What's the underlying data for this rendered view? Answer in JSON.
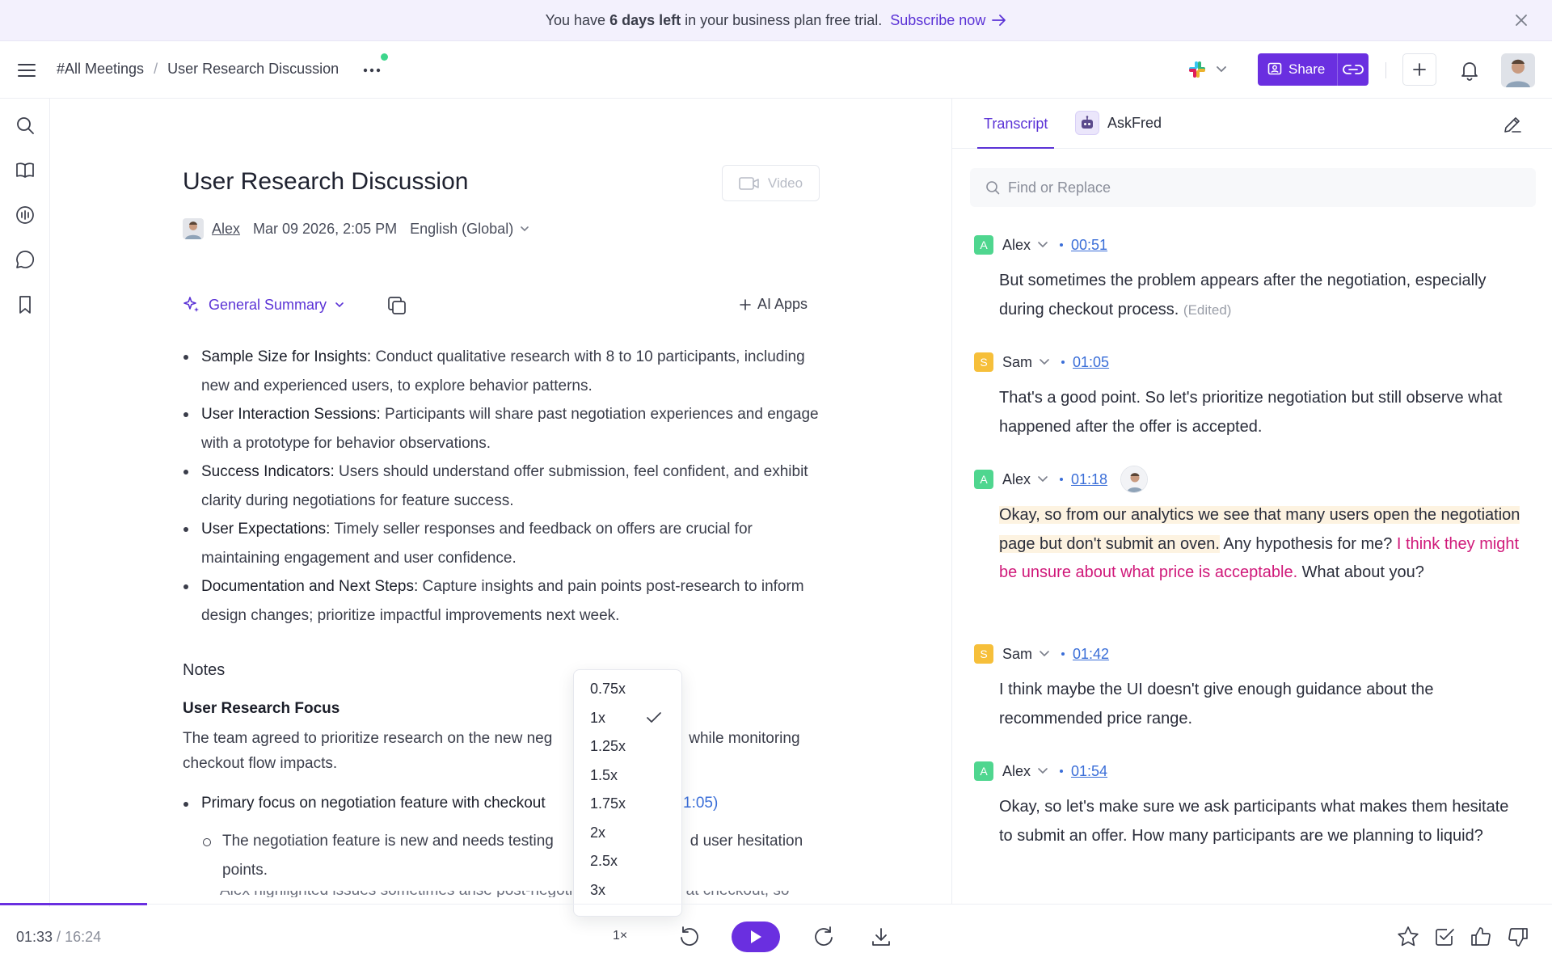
{
  "banner": {
    "prefix": "You have",
    "days": "6 days left",
    "suffix": "in your business plan free trial.",
    "link": "Subscribe now"
  },
  "header": {
    "breadcrumb_root": "#All Meetings",
    "breadcrumb_sep": "/",
    "breadcrumb_current": "User Research Discussion",
    "share_label": "Share"
  },
  "doc": {
    "title": "User Research Discussion",
    "video_label": "Video",
    "author": "Alex",
    "date": "Mar 09 2026, 2:05 PM",
    "language": "English (Global)",
    "summary_type": "General Summary",
    "ai_apps_label": "AI Apps",
    "bullets": [
      {
        "title": "Sample Size for Insights:",
        "text": "Conduct qualitative research with 8 to 10 participants, including new and experienced users, to explore behavior patterns."
      },
      {
        "title": "User Interaction Sessions:",
        "text": "Participants will share past negotiation experiences and engage with a prototype for behavior observations."
      },
      {
        "title": "Success Indicators:",
        "text": "Users should understand offer submission, feel confident, and exhibit clarity during negotiations for feature success."
      },
      {
        "title": "User Expectations:",
        "text": "Timely seller responses and feedback on offers are crucial for maintaining engagement and user confidence."
      },
      {
        "title": "Documentation and Next Steps:",
        "text": "Capture insights and pain points post-research to inform design changes; prioritize impactful improvements next week."
      }
    ],
    "notes_heading": "Notes",
    "focus_heading": "User Research Focus",
    "focus_text": "The team agreed to prioritize research on the new neg                                while monitoring checkout flow impacts.",
    "focus_bullet": "Primary focus on negotiation feature with checkout",
    "focus_bullet_ts": "1:05)",
    "sub_bullet": "The negotiation feature is new and needs testing                                d user hesitation points.",
    "cut_line": "Alex highlighted issues sometimes arise post-negotiation, especially at checkout, so both"
  },
  "speed_menu": {
    "options": [
      "0.75x",
      "1x",
      "1.25x",
      "1.5x",
      "1.75x",
      "2x",
      "2.5x",
      "3x"
    ],
    "selected": "1x"
  },
  "panel": {
    "tab_transcript": "Transcript",
    "tab_askfred": "AskFred",
    "search_placeholder": "Find or Replace",
    "entries": [
      {
        "speaker": "Alex",
        "initial": "A",
        "time": "00:51",
        "text": "But sometimes the problem appears after the negotiation, especially during checkout process.",
        "edited": "(Edited)"
      },
      {
        "speaker": "Sam",
        "initial": "S",
        "time": "01:05",
        "text": "That's a good point. So let's prioritize negotiation but still observe what happened after the offer is accepted."
      },
      {
        "speaker": "Alex",
        "initial": "A",
        "time": "01:18",
        "text_hl": "Okay, so from our analytics we see that many users open the negotiation page but don't submit an oven.",
        "text_mid": " Any hypothesis for me? ",
        "text_pink": "I think they might be unsure about what price is acceptable.",
        "text_end": " What about you?"
      },
      {
        "speaker": "Sam",
        "initial": "S",
        "time": "01:42",
        "text": "I think maybe the UI doesn't give enough guidance about the recommended price range."
      },
      {
        "speaker": "Alex",
        "initial": "A",
        "time": "01:54",
        "text": "Okay, so let's make sure we ask participants what makes them hesitate to submit an offer. How many participants are we planning to liquid?"
      }
    ]
  },
  "player": {
    "current": "01:33",
    "sep": " / ",
    "total": "16:24",
    "speed": "1×",
    "progress": 0.095
  },
  "colors": {
    "accent": "#6a2fe0",
    "badge_alex": "#4fd68f",
    "badge_sam": "#f6bf3a",
    "highlight": "#fdf3e1",
    "pink": "#d0197a",
    "link": "#3a6ed8"
  }
}
